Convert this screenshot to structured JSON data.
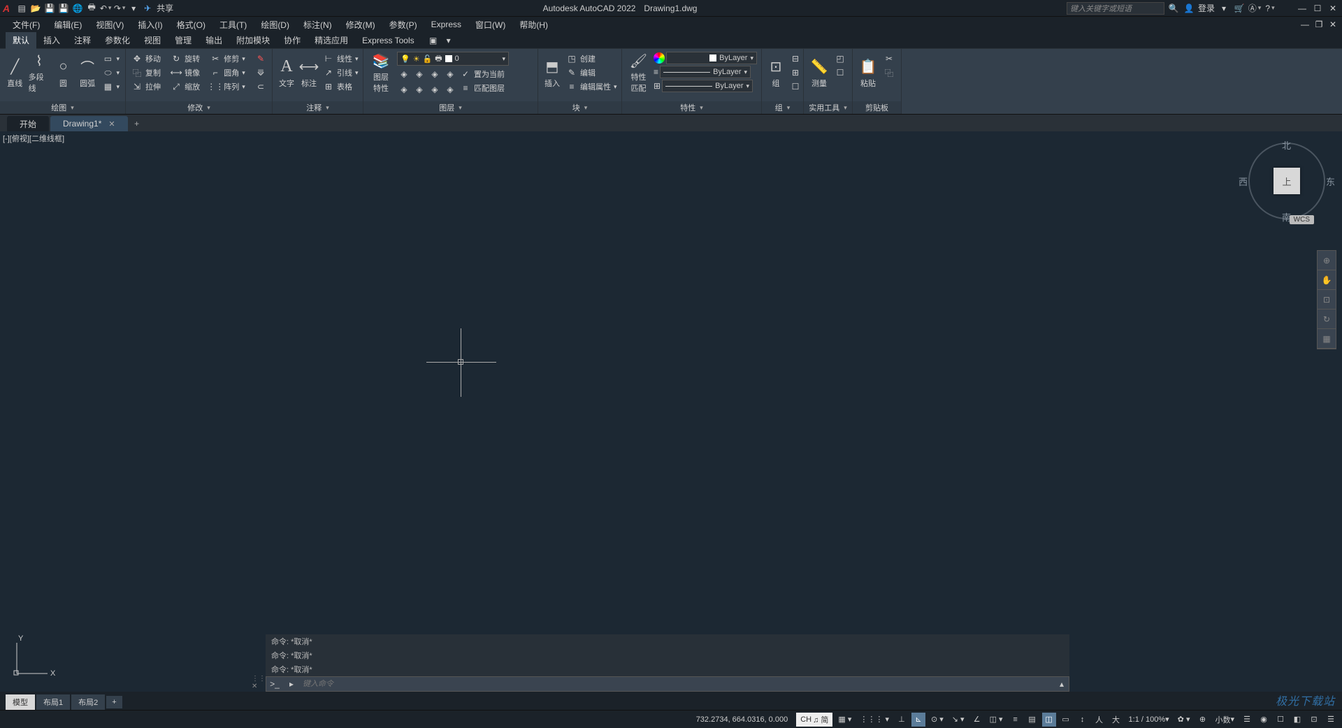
{
  "title": {
    "app": "Autodesk AutoCAD 2022",
    "file": "Drawing1.dwg"
  },
  "share": "共享",
  "search_placeholder": "键入关键字或短语",
  "login": "登录",
  "menubar": [
    "文件(F)",
    "编辑(E)",
    "视图(V)",
    "插入(I)",
    "格式(O)",
    "工具(T)",
    "绘图(D)",
    "标注(N)",
    "修改(M)",
    "参数(P)",
    "Express",
    "窗口(W)",
    "帮助(H)"
  ],
  "ribbon_tabs": [
    "默认",
    "插入",
    "注释",
    "参数化",
    "视图",
    "管理",
    "输出",
    "附加模块",
    "协作",
    "精选应用",
    "Express Tools"
  ],
  "panels": {
    "draw": {
      "title": "绘图",
      "line": "直线",
      "pline": "多段线",
      "circle": "圆",
      "arc": "圆弧"
    },
    "modify": {
      "title": "修改",
      "move": "移动",
      "rotate": "旋转",
      "trim": "修剪",
      "copy": "复制",
      "mirror": "镜像",
      "fillet": "圆角",
      "stretch": "拉伸",
      "scale": "缩放",
      "array": "阵列"
    },
    "annot": {
      "title": "注释",
      "text": "文字",
      "dim": "标注",
      "linear": "线性",
      "leader": "引线",
      "table": "表格"
    },
    "layers": {
      "title": "图层",
      "props": "图层\n特性",
      "current": "0",
      "setcur": "置为当前",
      "match": "匹配图层"
    },
    "block": {
      "title": "块",
      "insert": "插入",
      "create": "创建",
      "edit": "编辑",
      "editattr": "编辑属性"
    },
    "props": {
      "title": "特性",
      "match": "特性\n匹配",
      "bylayer": "ByLayer"
    },
    "group": {
      "title": "组",
      "group": "组"
    },
    "utils": {
      "title": "实用工具",
      "measure": "测量"
    },
    "clip": {
      "title": "剪贴板",
      "paste": "粘贴"
    }
  },
  "file_tabs": {
    "start": "开始",
    "drawing": "Drawing1*"
  },
  "viewport_label": "[-][俯视][二维线框]",
  "navcube": {
    "n": "北",
    "s": "南",
    "e": "东",
    "w": "西",
    "top": "上",
    "wcs": "WCS"
  },
  "ucs": {
    "x": "X",
    "y": "Y"
  },
  "cmd": {
    "hist1": "命令: *取消*",
    "hist2": "命令: *取消*",
    "hist3": "命令: *取消*",
    "placeholder": "键入命令"
  },
  "layout_tabs": [
    "模型",
    "布局1",
    "布局2"
  ],
  "status": {
    "coords": "732.2734, 664.0316, 0.000",
    "ime": "CH",
    "ime2": "♫ 简",
    "scale": "1:1 / 100%",
    "decimal": "小数"
  },
  "watermark": "极光下载站"
}
